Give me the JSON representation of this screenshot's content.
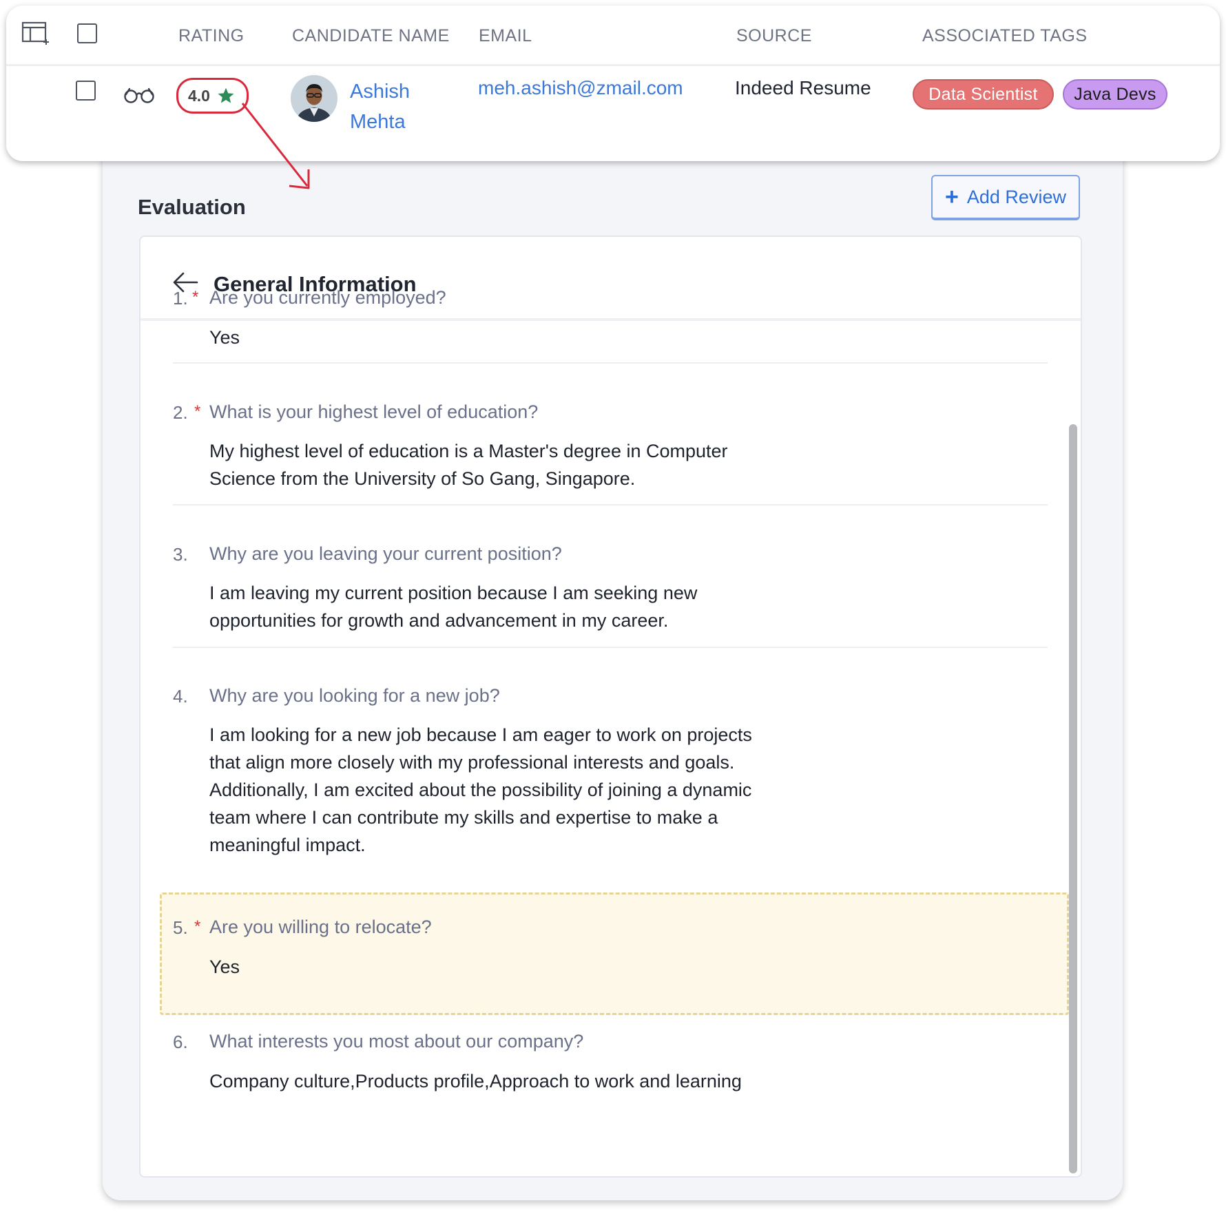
{
  "table": {
    "headers": {
      "rating": "RATING",
      "candidate_name": "CANDIDATE NAME",
      "email": "EMAIL",
      "source": "SOURCE",
      "associated_tags": "ASSOCIATED TAGS"
    },
    "row": {
      "rating": "4.0",
      "candidate_name": "Ashish Mehta",
      "email": "meh.ashish@zmail.com",
      "source": "Indeed Resume",
      "tags": [
        "Data Scientist",
        "Java Devs"
      ]
    }
  },
  "evaluation": {
    "title": "Evaluation",
    "add_review_label": "Add Review",
    "section_title": "General Information",
    "questions": [
      {
        "num": "1.",
        "required": "*",
        "question": "Are you currently employed?",
        "answer": "Yes"
      },
      {
        "num": "2.",
        "required": "*",
        "question": "What is your highest level of education?",
        "answer": "My highest level of education is a Master's degree in Computer Science from the University of So Gang, Singapore."
      },
      {
        "num": "3.",
        "required": "",
        "question": "Why are you leaving your current position?",
        "answer": "I am leaving my current position because I am seeking new opportunities for growth and advancement in my career."
      },
      {
        "num": "4.",
        "required": "",
        "question": "Why are you looking for a new job?",
        "answer": "I am looking for a new job because I am eager to work on projects that align more closely with my professional interests and goals. Additionally, I am excited about the possibility of joining a dynamic team where I can contribute my skills and expertise to make a meaningful impact."
      },
      {
        "num": "5.",
        "required": "*",
        "question": "Are you willing to relocate?",
        "answer": "Yes"
      },
      {
        "num": "6.",
        "required": "",
        "question": "What interests you most about our company?",
        "answer": "Company culture,Products profile,Approach to work and learning"
      }
    ]
  },
  "colors": {
    "accent": "#3c78d8",
    "rating_highlight": "#d9293c",
    "star": "#2e8b57",
    "tag_data_scientist": "#e57373",
    "tag_java_devs": "#c89af0",
    "required_marker": "#d6373b",
    "highlight_bg": "#fdf8e7"
  }
}
